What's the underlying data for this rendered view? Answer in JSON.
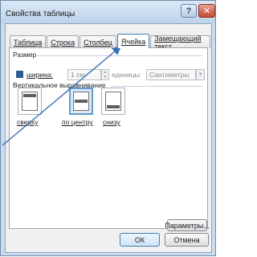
{
  "dialog": {
    "title": "Свойства таблицы"
  },
  "tabs": [
    {
      "label": "Таблица",
      "active": false
    },
    {
      "label": "Строка",
      "active": false
    },
    {
      "label": "Столбец",
      "active": false
    },
    {
      "label": "Ячейка",
      "active": true
    },
    {
      "label": "Замещающий текст",
      "active": false
    }
  ],
  "size": {
    "section_label": "Размер",
    "width_checkbox_checked": true,
    "width_label": "ширина:",
    "width_value": "1 см",
    "units_label": "единицы:",
    "units_value": "Сантиметры"
  },
  "valign": {
    "section_label": "Вертикальное выравнивание",
    "options": [
      {
        "label": "сверху",
        "selected": false
      },
      {
        "label": "по центру",
        "selected": true
      },
      {
        "label": "снизу",
        "selected": false
      }
    ]
  },
  "buttons": {
    "params": "Параметры...",
    "ok": "ОК",
    "cancel": "Отмена"
  },
  "colors": {
    "annotation_arrow": "#3a6fb4",
    "selection_accent": "#5f9cd1"
  },
  "icons": {
    "help": "question-icon",
    "close": "close-icon"
  }
}
